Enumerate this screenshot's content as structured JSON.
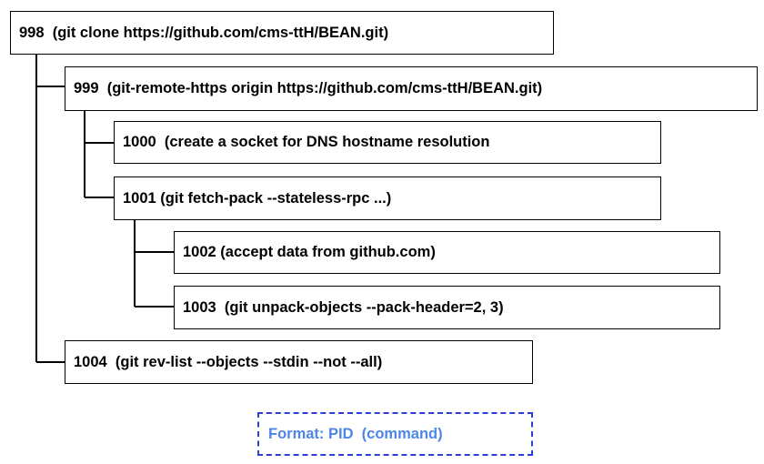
{
  "processes": [
    {
      "id": "p998",
      "text": "998  (git clone https://github.com/cms-ttH/BEAN.git)"
    },
    {
      "id": "p999",
      "text": "999  (git-remote-https origin https://github.com/cms-ttH/BEAN.git)"
    },
    {
      "id": "p1000",
      "text": "1000  (create a socket for DNS hostname resolution"
    },
    {
      "id": "p1001",
      "text": "1001 (git fetch-pack --stateless-rpc ...)"
    },
    {
      "id": "p1002",
      "text": "1002 (accept data from github.com)"
    },
    {
      "id": "p1003",
      "text": "1003  (git unpack-objects --pack-header=2, 3)"
    },
    {
      "id": "p1004",
      "text": "1004  (git rev-list --objects --stdin --not --all)"
    }
  ],
  "legend": {
    "text": "Format: PID  (command)"
  },
  "colors": {
    "line": "#000000",
    "legend_border": "#2b3fd8",
    "legend_text": "#4f86e6"
  }
}
